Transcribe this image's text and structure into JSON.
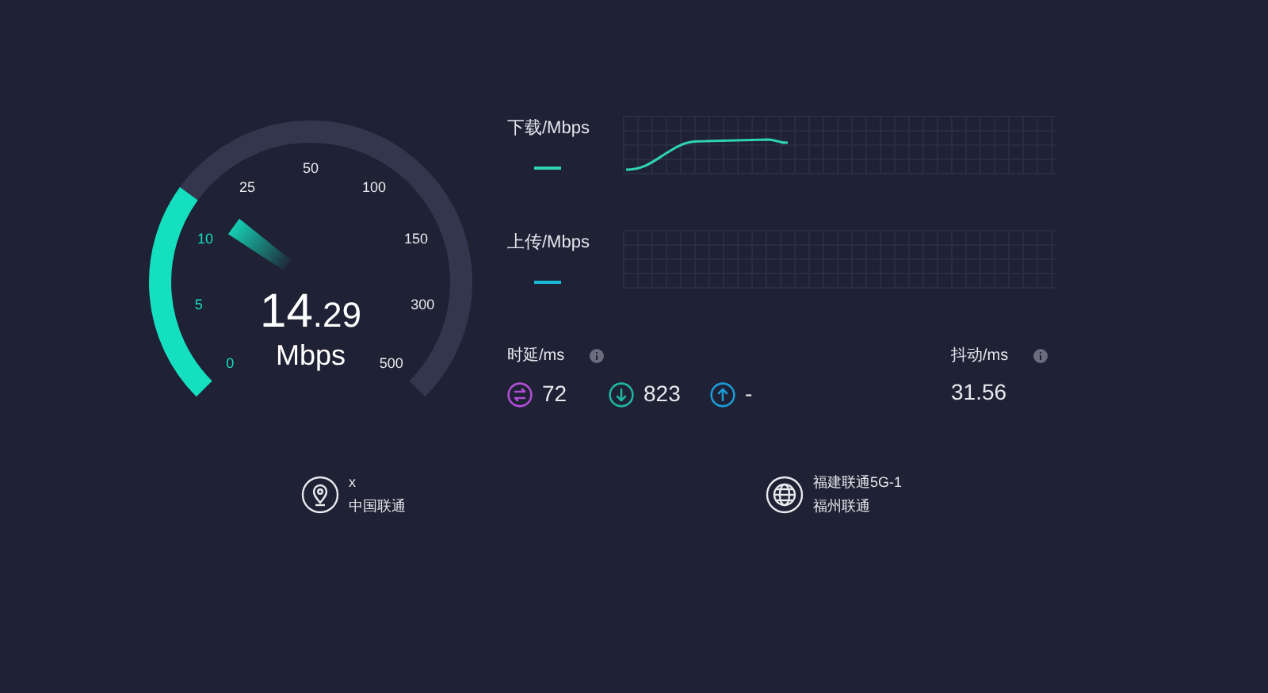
{
  "gauge": {
    "value_int": "14",
    "value_dec": ".29",
    "unit": "Mbps",
    "ticks": [
      {
        "label": "0",
        "reached": true
      },
      {
        "label": "5",
        "reached": true
      },
      {
        "label": "10",
        "reached": true
      },
      {
        "label": "25",
        "reached": false
      },
      {
        "label": "50",
        "reached": false
      },
      {
        "label": "100",
        "reached": false
      },
      {
        "label": "150",
        "reached": false
      },
      {
        "label": "300",
        "reached": false
      },
      {
        "label": "500",
        "reached": false
      }
    ]
  },
  "charts": [
    {
      "kind": "download",
      "label": "下载/Mbps",
      "color": "#2ed3b0"
    },
    {
      "kind": "upload",
      "label": "上传/Mbps",
      "color": "#18b8d8"
    }
  ],
  "latency": {
    "label": "时延/ms",
    "items": [
      {
        "kind": "idle",
        "value": "72",
        "color": "#b04fd6"
      },
      {
        "kind": "down",
        "value": "823",
        "color": "#1fb5a0"
      },
      {
        "kind": "up",
        "value": "-",
        "color": "#1a9bd8"
      }
    ]
  },
  "jitter": {
    "label": "抖动/ms",
    "value": "31.56"
  },
  "client": {
    "kind": "location",
    "line1": "x",
    "line2": "中国联通"
  },
  "server": {
    "kind": "globe",
    "line1": "福建联通5G-1",
    "line2": "福州联通"
  }
}
